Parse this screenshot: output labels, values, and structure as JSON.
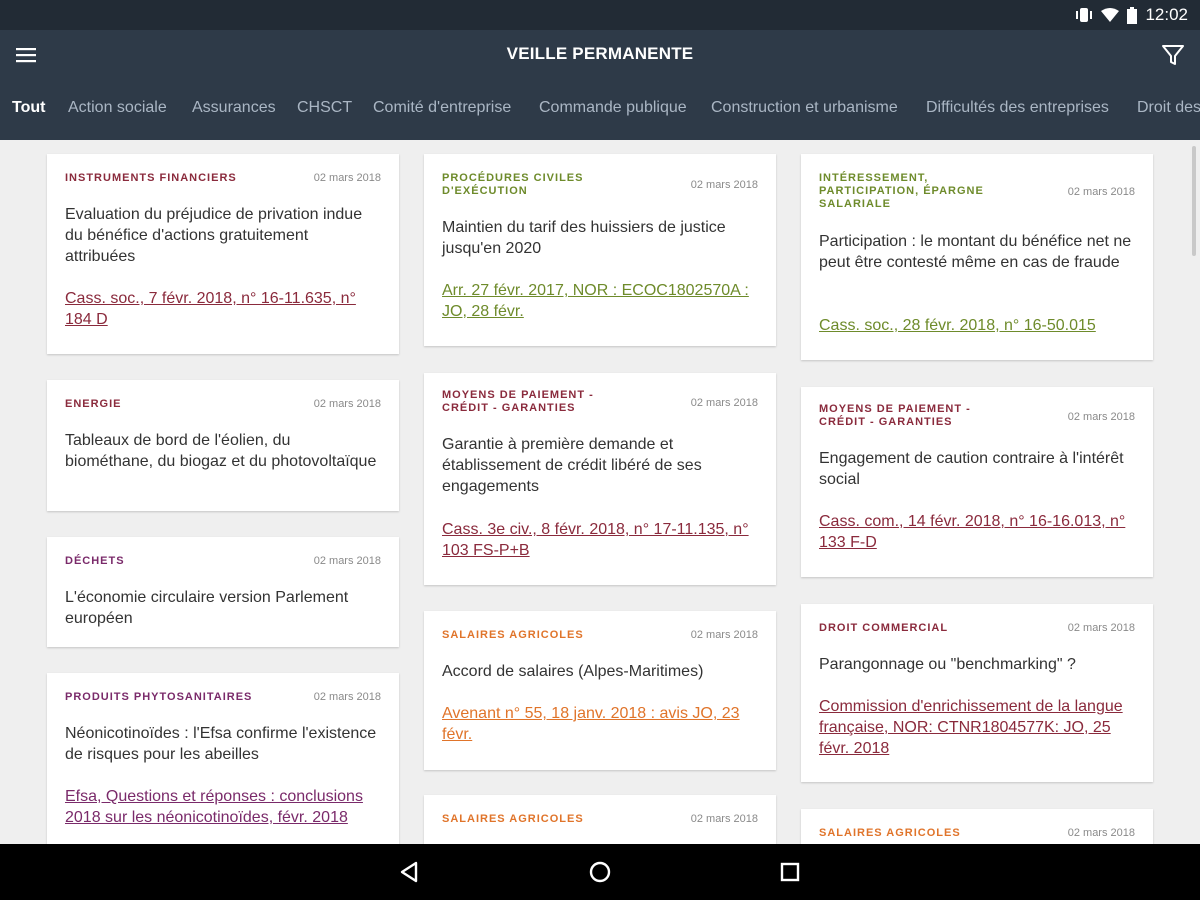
{
  "status": {
    "time": "12:02"
  },
  "app": {
    "title": "VEILLE PERMANENTE"
  },
  "tabs": [
    "Tout",
    "Action sociale",
    "Assurances",
    "CHSCT",
    "Comité d'entreprise",
    "Commande publique",
    "Construction et urbanisme",
    "Difficultés des entreprises",
    "Droit des"
  ],
  "colors": {
    "statusbar": "#222b35",
    "appbar": "#2e3a48",
    "category_maroon": "#8a2a3c",
    "category_purple": "#7a2a6a",
    "category_olive": "#6e8b2b",
    "category_orange": "#e0742a"
  },
  "cards": [
    {
      "category": "Instruments financiers",
      "date": "02 mars 2018",
      "title": "Evaluation du préjudice de privation indue du bénéfice d'actions gratuitement attribuées",
      "link": "Cass. soc., 7 févr. 2018, n° 16-11.635, n° 184 D"
    },
    {
      "category": "Energie",
      "date": "02 mars 2018",
      "title": "Tableaux de bord de l'éolien, du biométhane, du biogaz et du photovoltaïque",
      "link": ""
    },
    {
      "category": "Déchets",
      "date": "02 mars 2018",
      "title": "L'économie circulaire version Parlement européen",
      "link": ""
    },
    {
      "category": "Produits phytosanitaires",
      "date": "02 mars 2018",
      "title": "Néonicotinoïdes : l'Efsa confirme l'existence de risques pour les abeilles",
      "link": "Efsa, Questions et réponses : conclusions 2018 sur les néonicotinoïdes, févr. 2018"
    },
    {
      "category": "Procédures civiles d'exécution",
      "date": "02 mars 2018",
      "title": "Maintien du tarif des huissiers de justice jusqu'en 2020",
      "link": "Arr. 27 févr. 2017, NOR : ECOC1802570A : JO, 28 févr."
    },
    {
      "category": "Moyens de paiement - Crédit - Garanties",
      "date": "02 mars 2018",
      "title": "Garantie à première demande et établissement de crédit libéré de ses engagements",
      "link": "Cass. 3e civ., 8 févr. 2018, n° 17-11.135, n° 103 FS-P+B"
    },
    {
      "category": "Salaires agricoles",
      "date": "02 mars 2018",
      "title": "Accord de salaires (Alpes-Maritimes)",
      "link": "Avenant n° 55, 18 janv. 2018 : avis JO, 23 févr."
    },
    {
      "category": "Salaires agricoles",
      "date": "02 mars 2018",
      "title": "",
      "link": ""
    },
    {
      "category": "Intéressement, participation, épargne salariale",
      "date": "02 mars 2018",
      "title": "Participation : le montant du bénéfice net ne peut être contesté même en cas de fraude",
      "link": "Cass. soc., 28 févr. 2018, n° 16-50.015"
    },
    {
      "category": "Moyens de paiement - Crédit - Garanties",
      "date": "02 mars 2018",
      "title": "Engagement de caution contraire à l'intérêt social",
      "link": "Cass. com., 14 févr. 2018, n° 16-16.013, n° 133 F-D"
    },
    {
      "category": "Droit commercial",
      "date": "02 mars 2018",
      "title": "Parangonnage ou \"benchmarking\" ?",
      "link": "Commission d'enrichissement de la langue française, NOR: CTNR1804577K: JO, 25 févr. 2018"
    },
    {
      "category": "Salaires agricoles",
      "date": "02 mars 2018",
      "title": "",
      "link": ""
    }
  ]
}
